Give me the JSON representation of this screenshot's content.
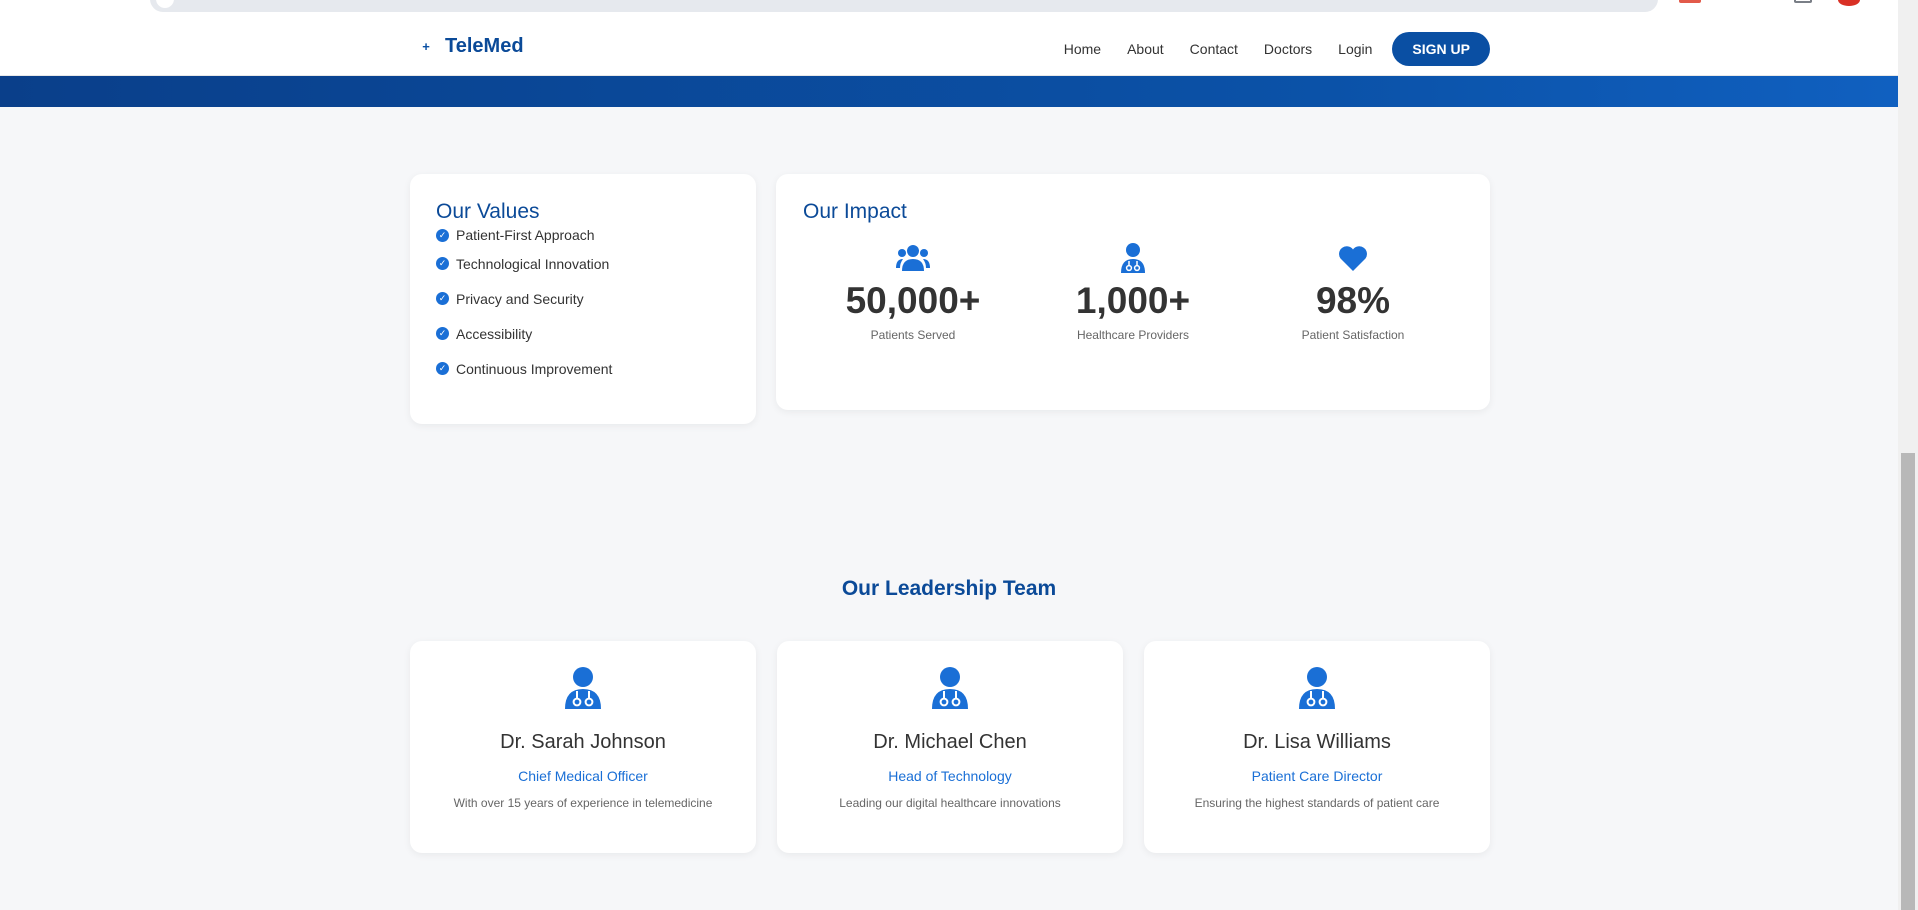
{
  "header": {
    "brand_icon": "plus-icon",
    "brand_name": "TeleMed",
    "nav": [
      "Home",
      "About",
      "Contact",
      "Doctors",
      "Login"
    ],
    "signup_label": "SIGN UP"
  },
  "colors": {
    "primary": "#0b4a98",
    "accent": "#1a6fd6",
    "band": "#0b52a8",
    "background": "#f6f7f9"
  },
  "values": {
    "title": "Our Values",
    "items": [
      "Patient-First Approach",
      "Technological Innovation",
      "Privacy and Security",
      "Accessibility",
      "Continuous Improvement"
    ]
  },
  "impact": {
    "title": "Our Impact",
    "stats": [
      {
        "icon": "users-icon",
        "value": "50,000+",
        "label": "Patients Served"
      },
      {
        "icon": "doctor-icon",
        "value": "1,000+",
        "label": "Healthcare Providers"
      },
      {
        "icon": "heart-icon",
        "value": "98%",
        "label": "Patient Satisfaction"
      }
    ]
  },
  "leadership": {
    "title": "Our Leadership Team",
    "members": [
      {
        "name": "Dr. Sarah Johnson",
        "role": "Chief Medical Officer",
        "desc": "With over 15 years of experience in telemedicine"
      },
      {
        "name": "Dr. Michael Chen",
        "role": "Head of Technology",
        "desc": "Leading our digital healthcare innovations"
      },
      {
        "name": "Dr. Lisa Williams",
        "role": "Patient Care Director",
        "desc": "Ensuring the highest standards of patient care"
      }
    ]
  }
}
